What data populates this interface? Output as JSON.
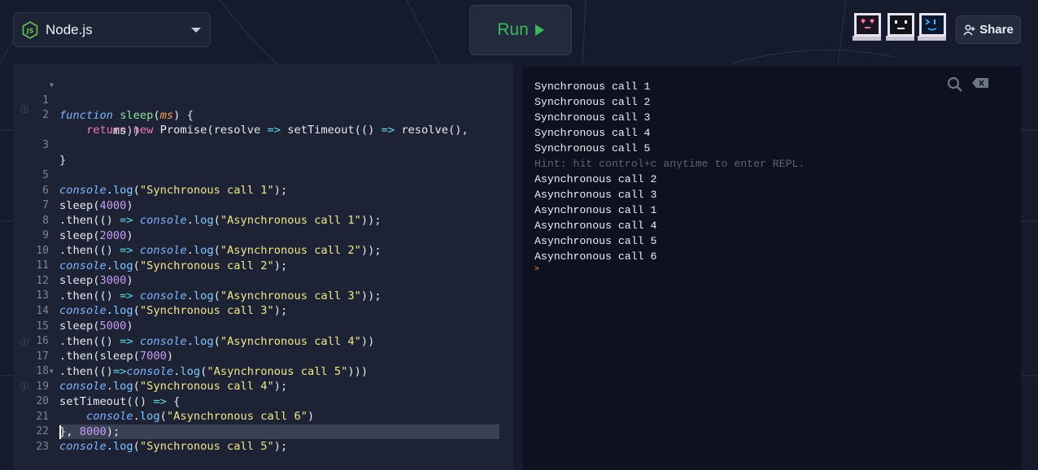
{
  "toolbar": {
    "language": "Node.js",
    "run_label": "Run",
    "share_label": "Share"
  },
  "editor": {
    "line_numbers": [
      "1",
      "2",
      "",
      "3",
      "",
      "5",
      "6",
      "7",
      "8",
      "9",
      "10",
      "11",
      "12",
      "13",
      "14",
      "15",
      "16",
      "17",
      "18",
      "19",
      "20",
      "21",
      "22",
      "23"
    ],
    "active_line": "23"
  },
  "output": {
    "lines": [
      "Synchronous call 1",
      "Synchronous call 2",
      "Synchronous call 3",
      "Synchronous call 4",
      "Synchronous call 5",
      "Hint: hit control+c anytime to enter REPL.",
      "Asynchronous call 2",
      "Asynchronous call 3",
      "Asynchronous call 1",
      "Asynchronous call 4",
      "Asynchronous call 5",
      "Asynchronous call 6"
    ],
    "prompt": ">"
  },
  "icons": {
    "language": "nodejs-icon",
    "dropdown": "chevron-down-icon",
    "run": "play-icon",
    "share": "add-user-icon",
    "search": "search-icon",
    "clear": "backspace-icon"
  },
  "colors": {
    "run_accent": "#3fb75b",
    "keyword": "#f07ab5",
    "function": "#92e39a",
    "string": "#f0e68c",
    "number": "#c79bf5"
  }
}
